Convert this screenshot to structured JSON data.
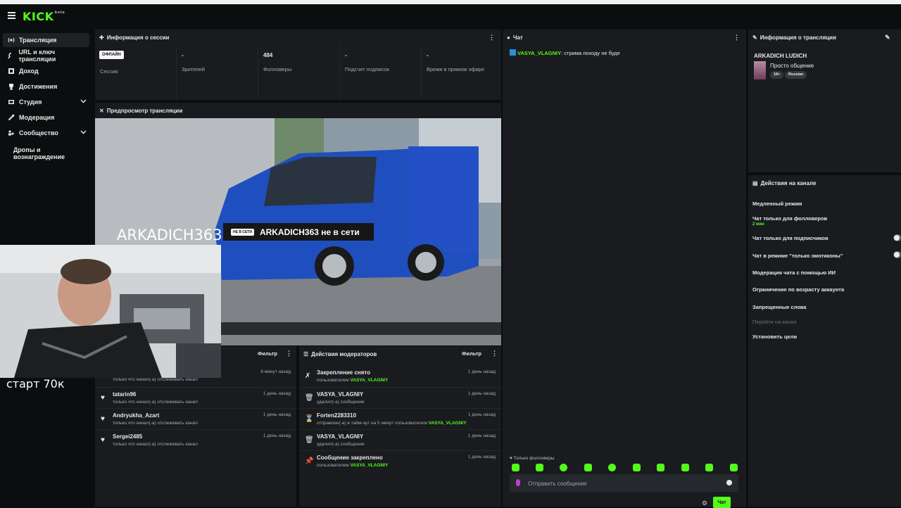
{
  "app": {
    "logo_text": "KICK",
    "logo_sup": "beta"
  },
  "sidebar": {
    "items": [
      {
        "label": "Трансляция",
        "icon": "broadcast-icon"
      },
      {
        "label": "URL и ключ трансляции",
        "icon": "key-icon"
      },
      {
        "label": "Доход",
        "icon": "income-icon"
      },
      {
        "label": "Достижения",
        "icon": "trophy-icon"
      },
      {
        "label": "Студия",
        "icon": "studio-icon"
      },
      {
        "label": "Модерация",
        "icon": "wrench-icon"
      },
      {
        "label": "Сообщество",
        "icon": "community-icon"
      }
    ],
    "sub_item": "Дропы и вознаграждение"
  },
  "session": {
    "title": "Информация о сессии",
    "stats": [
      {
        "value": "ОФЛАЙН",
        "label": "Сессия"
      },
      {
        "value": "-",
        "label": "Зрителей"
      },
      {
        "value": "484",
        "label": "Фолловеры"
      },
      {
        "value": "-",
        "label": "Подсчет подписок"
      },
      {
        "value": "-",
        "label": "Время в прямом эфире"
      }
    ]
  },
  "preview": {
    "title": "Предпросмотр трансляции",
    "offline_badge": "НЕ В СЕТИ",
    "offline_text": "ARKADICH363 не в сети"
  },
  "overlay": {
    "watermark": "ARKADICH363",
    "start_text": "старт 70к"
  },
  "activity": {
    "filter": "Фильтр",
    "rows": [
      {
        "name": "",
        "sub": "только что начал(-а) отслеживать канал",
        "time": "6 минут назад"
      },
      {
        "name": "tatarin96",
        "sub": "только что начал(-а) отслеживать канал",
        "time": "1 день назад"
      },
      {
        "name": "Andryukha_Azart",
        "sub": "только что начал(-а) отслеживать канал",
        "time": "1 день назад"
      },
      {
        "name": "Sergei2485",
        "sub": "только что начал(-а) отслеживать канал",
        "time": "1 день назад"
      }
    ]
  },
  "mod_actions": {
    "title": "Действия модераторов",
    "filter": "Фильтр",
    "rows": [
      {
        "icon": "unpin-icon",
        "name": "Закрепление снято",
        "sub_pre": "пользователем ",
        "user": "VASYA_VLAGNIY",
        "time": "1 день назад"
      },
      {
        "icon": "trash-icon",
        "name": "VASYA_VLAGNIY",
        "sub_pre": "удалил(-а) сообщение",
        "user": "",
        "time": "1 день назад"
      },
      {
        "icon": "hourglass-icon",
        "name": "Forten2283310",
        "sub_pre": "отправлен(-а) в тайм-аут на 5 минут пользователем ",
        "user": "VASYA_VLAGNIY",
        "time": "1 день назад"
      },
      {
        "icon": "trash-icon",
        "name": "VASYA_VLAGNIY",
        "sub_pre": "удалил(-а) сообщение",
        "user": "",
        "time": "1 день назад"
      },
      {
        "icon": "pin-icon",
        "name": "Сообщение закреплено",
        "sub_pre": "пользователем ",
        "user": "VASYA_VLAGNIY",
        "time": "1 день назад"
      }
    ]
  },
  "chat": {
    "title": "Чат",
    "message": {
      "user": "VASYA_VLAGNIY",
      "text": ": стрима походу не буде"
    },
    "followers_only": "Только фолловеры",
    "input_placeholder": "Отправить сообщение",
    "send_label": "Чат"
  },
  "stream_info": {
    "title": "Информация о трансляции",
    "channel": "ARKADICH LUDICH",
    "category": "Просто общение",
    "tags": [
      "18+",
      "Russian"
    ]
  },
  "channel_actions": {
    "title": "Действия на канале",
    "slow_mode": "Медленный режим",
    "followers_chat": "Чат только для фолловеров",
    "followers_chat_sub": "2 мин",
    "subs_chat": "Чат только для подписчиков",
    "emote_chat": "Чат в режиме \"только эмотиконы\"",
    "ai_mod": "Модерация чата с помощью ИИ",
    "age_limit": "Ограничение по возрасту аккаунта",
    "banned_words": "Запрещенные слова",
    "go_channel": "Перейти на канал",
    "set_goals": "Установить цели"
  },
  "colors": {
    "accent": "#53fc18",
    "panel": "#191b1f",
    "background": "#0b0e0f"
  }
}
